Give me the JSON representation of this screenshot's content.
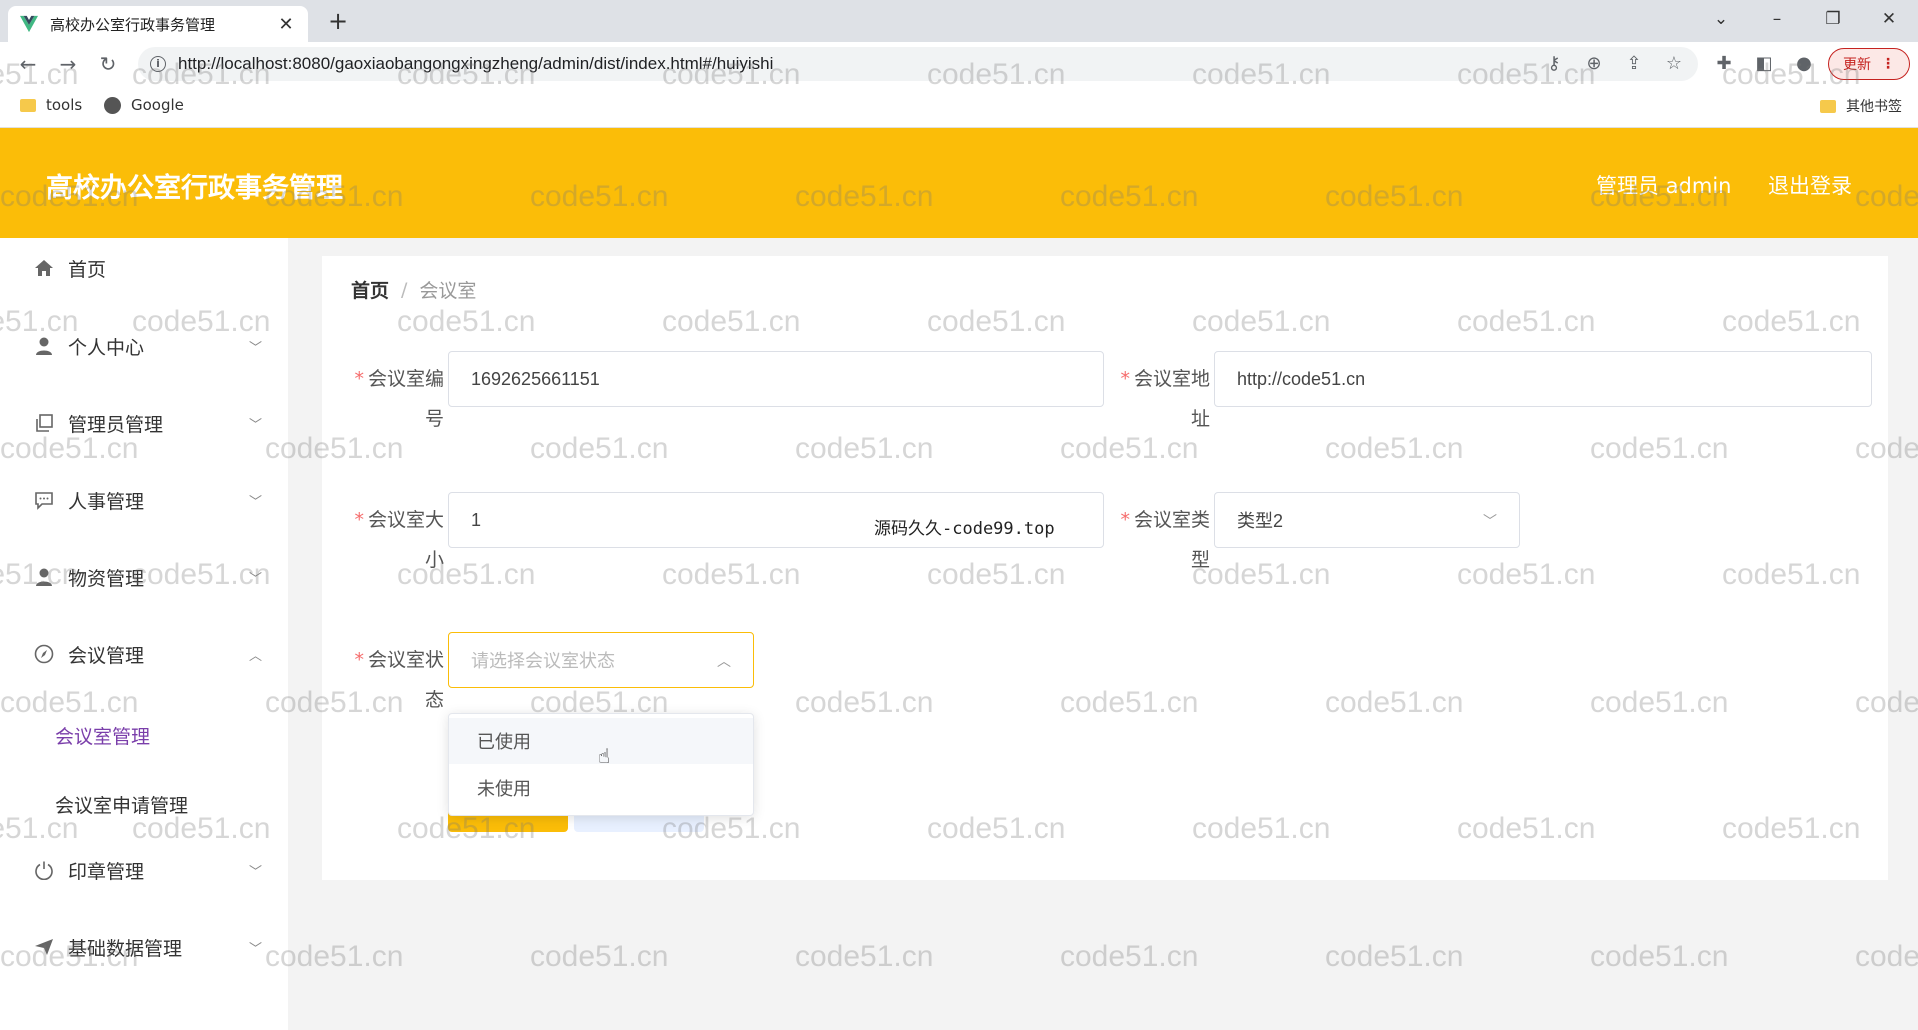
{
  "browser": {
    "tab_title": "高校办公室行政事务管理",
    "tab_close": "✕",
    "new_tab": "+",
    "url": "http://localhost:8080/gaoxiaobangongxingzheng/admin/dist/index.html#/huiyishi",
    "update_label": "更新",
    "bookmarks": [
      {
        "label": "tools",
        "icon": "folder-icon"
      },
      {
        "label": "Google",
        "icon": "globe-icon"
      }
    ],
    "other_bookmarks": "其他书签"
  },
  "header": {
    "title": "高校办公室行政事务管理",
    "admin_label": "管理员 admin",
    "logout_label": "退出登录"
  },
  "sidebar": {
    "items": [
      {
        "label": "首页",
        "icon": "home-icon"
      },
      {
        "label": "个人中心",
        "icon": "user-icon"
      },
      {
        "label": "管理员管理",
        "icon": "copy-icon"
      },
      {
        "label": "人事管理",
        "icon": "message-icon"
      },
      {
        "label": "物资管理",
        "icon": "user-icon"
      },
      {
        "label": "会议管理",
        "icon": "compass-icon"
      },
      {
        "label": "印章管理",
        "icon": "power-icon"
      },
      {
        "label": "基础数据管理",
        "icon": "send-icon"
      }
    ],
    "sub_items": [
      {
        "label": "会议室管理",
        "active": true
      },
      {
        "label": "会议室申请管理",
        "active": false
      }
    ]
  },
  "breadcrumb": {
    "home": "首页",
    "separator": "/",
    "current": "会议室"
  },
  "form": {
    "fields": {
      "room_number": {
        "label_line1": "会议室编",
        "label_line2": "号",
        "value": "1692625661151"
      },
      "room_address": {
        "label_line1": "会议室地",
        "label_line2": "址",
        "value": "http://code51.cn"
      },
      "room_size": {
        "label_line1": "会议室大",
        "label_line2": "小",
        "value": "1"
      },
      "room_type": {
        "label_line1": "会议室类",
        "label_line2": "型",
        "value": "类型2"
      },
      "room_status": {
        "label_line1": "会议室状",
        "label_line2": "态",
        "placeholder": "请选择会议室状态"
      }
    },
    "status_options": [
      "已使用",
      "未使用"
    ],
    "required_mark": "*"
  },
  "overlay_text": "源码久久-code99.top",
  "watermark": "code51.cn",
  "colors": {
    "accent": "#fbbd08",
    "active_sub": "#7a3eaa",
    "required": "#f56c6c"
  }
}
